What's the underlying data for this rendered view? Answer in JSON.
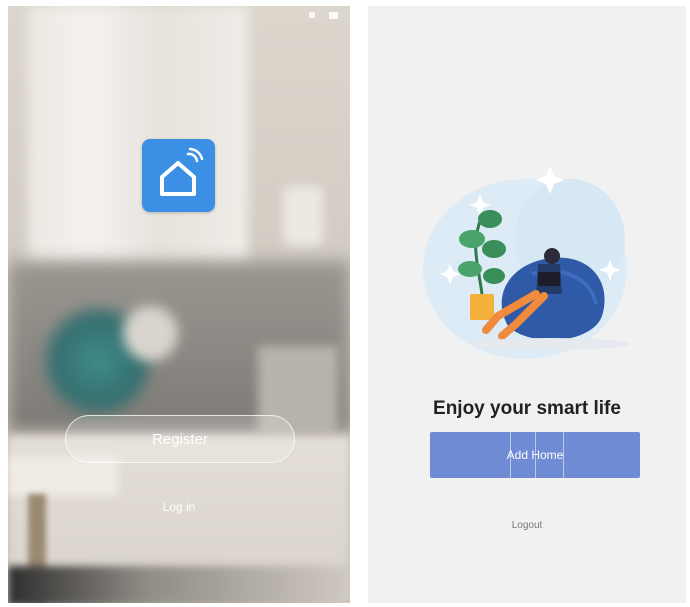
{
  "left_screen": {
    "app_logo_icon": "smart-home-icon",
    "register_label": "Register",
    "login_label": "Log in",
    "colors": {
      "logo_background": "#3b8fe4",
      "button_border": "#ffffff"
    }
  },
  "right_screen": {
    "illustration_icon": "person-on-beanbag-illustration",
    "slogan": "Enjoy your smart life",
    "add_home_label": "Add Home",
    "logout_label": "Logout",
    "colors": {
      "primary_button": "#6e8bd3",
      "background": "#f1f1f1"
    }
  }
}
